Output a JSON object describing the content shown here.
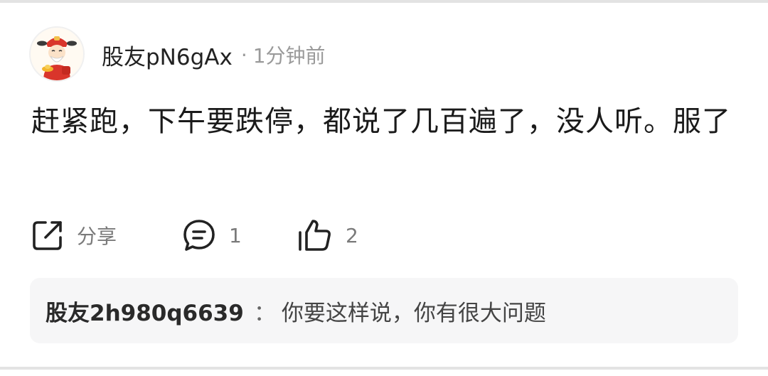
{
  "post": {
    "author": "股友pN6gAx",
    "separator": "·",
    "time": "1分钟前",
    "body": "赶紧跑，下午要跌停，都说了几百遍了，没人听。服了"
  },
  "actions": {
    "share_label": "分享",
    "comment_count": "1",
    "like_count": "2"
  },
  "reply": {
    "author": "股友2h980q6639",
    "separator": "：",
    "text": "你要这样说，你有很大问题"
  },
  "icons": {
    "avatar": "fortune-god-avatar-icon",
    "share": "share-icon",
    "comment": "comment-icon",
    "like": "thumbs-up-icon"
  },
  "colors": {
    "text_primary": "#1a1a1a",
    "text_secondary": "#9a9a9a",
    "reply_background": "#f6f6f7",
    "icon_stroke": "#222222"
  }
}
